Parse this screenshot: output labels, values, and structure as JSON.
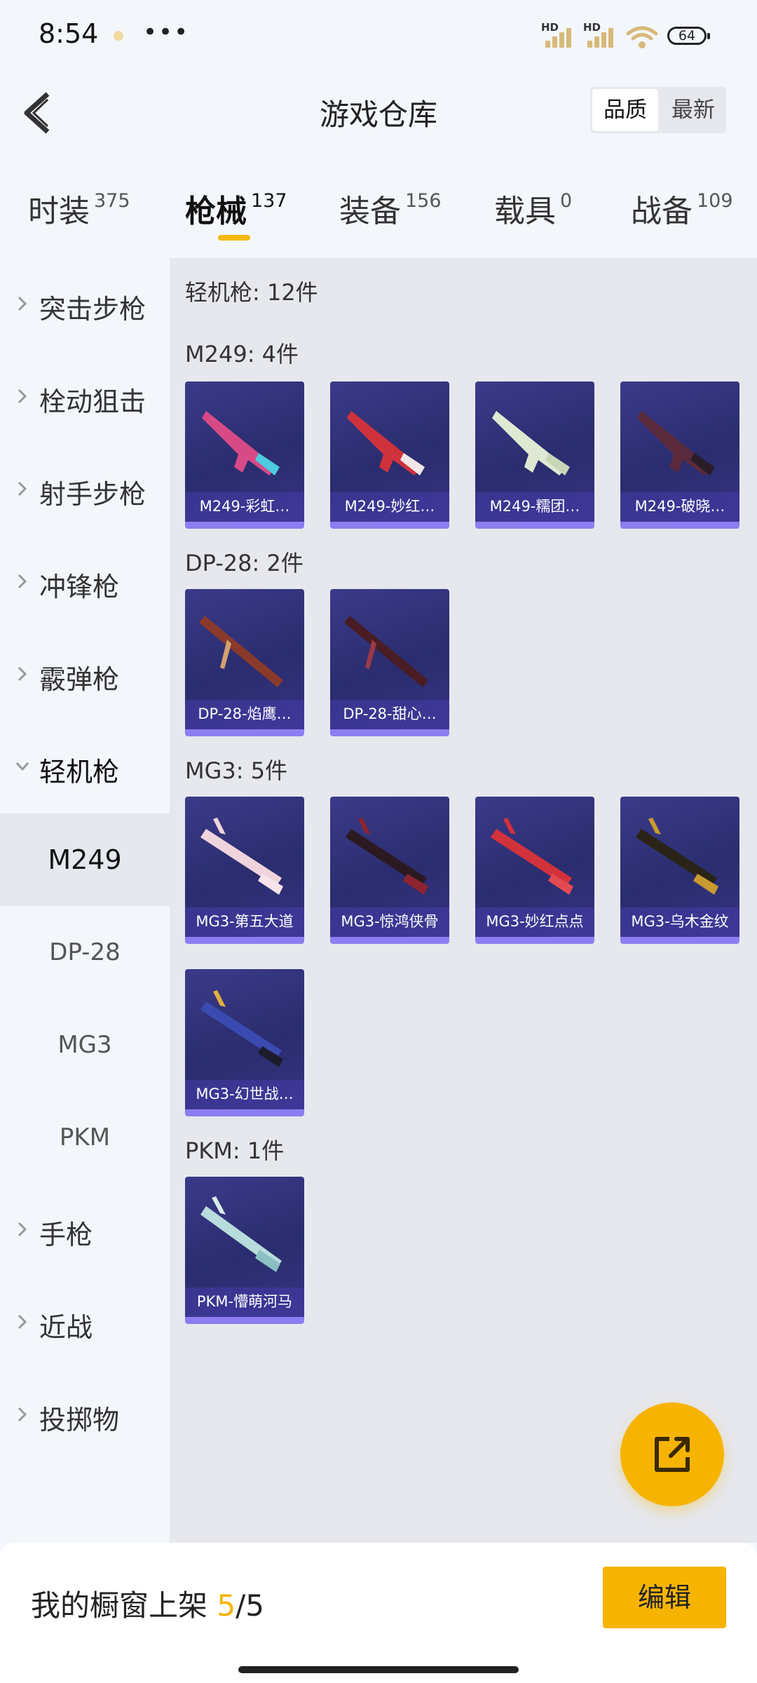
{
  "status": {
    "time": "8:54",
    "hd1": "HD",
    "hd2": "HD",
    "battery": "64"
  },
  "header": {
    "title": "游戏仓库",
    "sort": [
      "品质",
      "最新"
    ]
  },
  "tabs": [
    {
      "label": "时装",
      "count": "375"
    },
    {
      "label": "枪械",
      "count": "137"
    },
    {
      "label": "装备",
      "count": "156"
    },
    {
      "label": "载具",
      "count": "0"
    },
    {
      "label": "战备",
      "count": "109"
    }
  ],
  "sidebar": {
    "items": [
      "突击步枪",
      "栓动狙击",
      "射手步枪",
      "冲锋枪",
      "霰弹枪",
      "轻机枪"
    ],
    "subs": [
      "M249",
      "DP-28",
      "MG3",
      "PKM"
    ],
    "items_after": [
      "手枪",
      "近战",
      "投掷物"
    ]
  },
  "content": {
    "category_heading": "轻机枪: 12件",
    "groups": [
      {
        "heading": "M249: 4件",
        "cards": [
          "M249-彩虹…",
          "M249-妙红…",
          "M249-糯团…",
          "M249-破晓…"
        ]
      },
      {
        "heading": "DP-28: 2件",
        "cards": [
          "DP-28-焰鹰…",
          "DP-28-甜心…"
        ]
      },
      {
        "heading": "MG3: 5件",
        "cards": [
          "MG3-第五大道",
          "MG3-惊鸿侠骨",
          "MG3-妙红点点",
          "MG3-乌木金纹",
          "MG3-幻世战…"
        ]
      },
      {
        "heading": "PKM: 1件",
        "cards": [
          "PKM-懵萌河马"
        ]
      }
    ]
  },
  "bottom": {
    "label": "我的橱窗上架",
    "current": "5",
    "total": "/5",
    "edit": "编辑"
  },
  "colors": {
    "accent": "#f6b400",
    "card_bg": "#2e2f72",
    "card_strip": "#8c7ef0"
  }
}
